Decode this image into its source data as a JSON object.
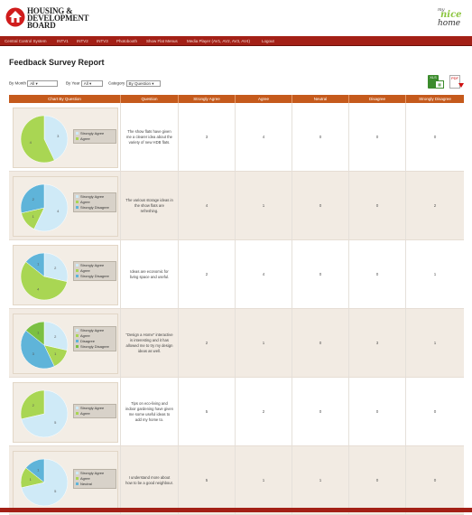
{
  "header": {
    "logo_lines": [
      "HOUSING &",
      "DEVELOPMENT",
      "BOARD"
    ],
    "brand_line1": "my",
    "brand_line2": "nice",
    "brand_line3": "home"
  },
  "nav": [
    "Central Control System",
    "INTV1",
    "INTV2",
    "INTV3",
    "Photobooth",
    "Show Flat Menus",
    "Media Player (AV1, AV2, AV3, AV4)",
    "Logout"
  ],
  "page_title": "Feedback Survey Report",
  "filters": {
    "month_label": "By Month",
    "month_value": "All",
    "year_label": "By Year",
    "year_value": "All",
    "category_label": "Category",
    "category_value": "By Question"
  },
  "export": {
    "excel_label": "XLS",
    "pdf_label": "PDF"
  },
  "table": {
    "headers": [
      "Chart By Question",
      "Question",
      "Strongly Agree",
      "Agree",
      "Neutral",
      "Disagree",
      "Strongly Disagree"
    ],
    "rows": [
      {
        "question": "The show flats have given me a clearer idea about the variety of new HDB flats.",
        "values": [
          "3",
          "4",
          "0",
          "0",
          "0"
        ],
        "legend": [
          {
            "label": "Strongly Agree",
            "color": "#cfeaf7"
          },
          {
            "label": "Agree",
            "color": "#a9d653"
          }
        ],
        "slices": [
          {
            "value": 3,
            "color": "#cfeaf7",
            "label": "3"
          },
          {
            "value": 4,
            "color": "#a9d653",
            "label": "4"
          }
        ]
      },
      {
        "question": "The various storage ideas in the show flats are refreshing.",
        "values": [
          "4",
          "1",
          "0",
          "0",
          "2"
        ],
        "legend": [
          {
            "label": "Strongly Agree",
            "color": "#cfeaf7"
          },
          {
            "label": "Agree",
            "color": "#a9d653"
          },
          {
            "label": "Strongly Disagree",
            "color": "#5fb4d9"
          }
        ],
        "slices": [
          {
            "value": 4,
            "color": "#cfeaf7",
            "label": "4"
          },
          {
            "value": 1,
            "color": "#a9d653",
            "label": "1"
          },
          {
            "value": 2,
            "color": "#5fb4d9",
            "label": "2"
          }
        ]
      },
      {
        "question": "Ideas are economic for living space and useful.",
        "values": [
          "2",
          "4",
          "0",
          "0",
          "1"
        ],
        "legend": [
          {
            "label": "Strongly Agree",
            "color": "#cfeaf7"
          },
          {
            "label": "Agree",
            "color": "#a9d653"
          },
          {
            "label": "Strongly Disagree",
            "color": "#5fb4d9"
          }
        ],
        "slices": [
          {
            "value": 2,
            "color": "#cfeaf7",
            "label": "2"
          },
          {
            "value": 4,
            "color": "#a9d653",
            "label": "4"
          },
          {
            "value": 1,
            "color": "#5fb4d9",
            "label": "1"
          }
        ]
      },
      {
        "question": "\"Design a Home\" interactive is interesting and it has allowed me to try my design ideas as well.",
        "values": [
          "2",
          "1",
          "0",
          "3",
          "1"
        ],
        "legend": [
          {
            "label": "Strongly Agree",
            "color": "#cfeaf7"
          },
          {
            "label": "Agree",
            "color": "#a9d653"
          },
          {
            "label": "Disagree",
            "color": "#5fb4d9"
          },
          {
            "label": "Strongly Disagree",
            "color": "#7bc043"
          }
        ],
        "slices": [
          {
            "value": 2,
            "color": "#cfeaf7",
            "label": "2"
          },
          {
            "value": 1,
            "color": "#a9d653",
            "label": "1"
          },
          {
            "value": 3,
            "color": "#5fb4d9",
            "label": "3"
          },
          {
            "value": 1,
            "color": "#7bc043",
            "label": "1"
          }
        ]
      },
      {
        "question": "Tips on eco-living and indoor gardening have given me some useful ideas to add my home to.",
        "values": [
          "5",
          "2",
          "0",
          "0",
          "0"
        ],
        "legend": [
          {
            "label": "Strongly Agree",
            "color": "#cfeaf7"
          },
          {
            "label": "Agree",
            "color": "#a9d653"
          }
        ],
        "slices": [
          {
            "value": 5,
            "color": "#cfeaf7",
            "label": "5"
          },
          {
            "value": 2,
            "color": "#a9d653",
            "label": "2"
          }
        ]
      },
      {
        "question": "I understand more about how to be a good neighbour.",
        "values": [
          "5",
          "1",
          "1",
          "0",
          "0"
        ],
        "legend": [
          {
            "label": "Strongly Agree",
            "color": "#cfeaf7"
          },
          {
            "label": "Agree",
            "color": "#a9d653"
          },
          {
            "label": "Neutral",
            "color": "#5fb4d9"
          }
        ],
        "slices": [
          {
            "value": 5,
            "color": "#cfeaf7",
            "label": "5"
          },
          {
            "value": 1,
            "color": "#a9d653",
            "label": "1"
          },
          {
            "value": 1,
            "color": "#5fb4d9",
            "label": "1"
          }
        ]
      }
    ]
  },
  "colors": {
    "nav_bg": "#a32016",
    "table_header": "#c55a1c",
    "row_alt": "#f2ebe3"
  }
}
